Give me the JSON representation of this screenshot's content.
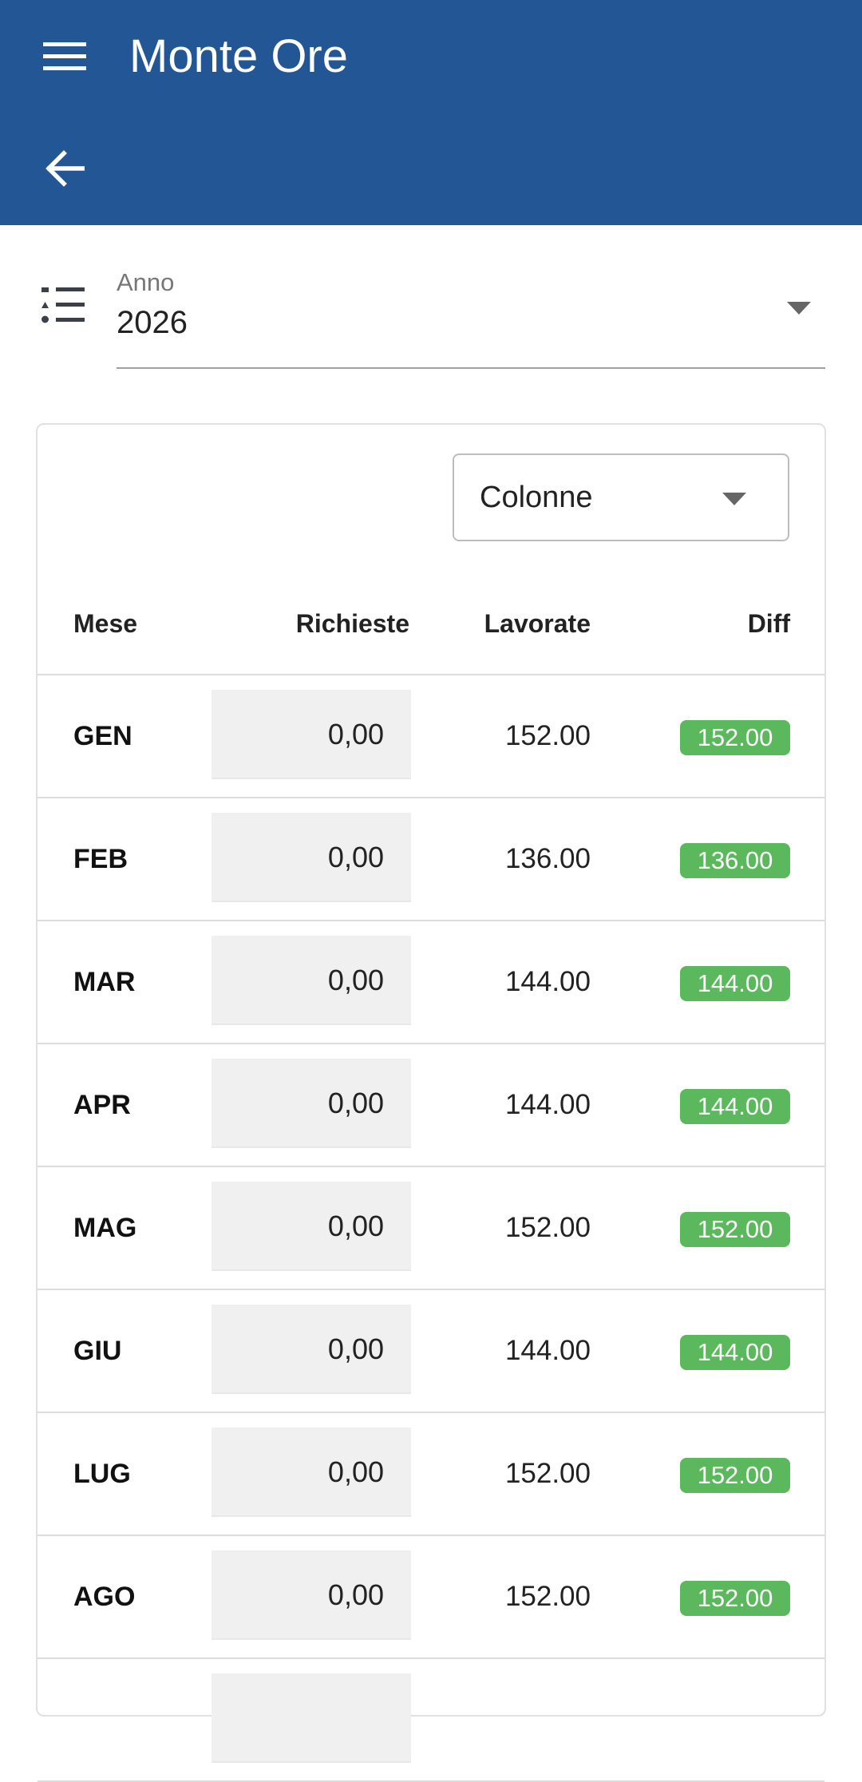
{
  "app": {
    "title": "Monte Ore",
    "header_color": "#235695"
  },
  "filter": {
    "label": "Anno",
    "value": "2026"
  },
  "columns_select": {
    "label": "Colonne"
  },
  "table": {
    "headers": {
      "mese": "Mese",
      "richieste": "Richieste",
      "lavorate": "Lavorate",
      "diff": "Diff"
    },
    "diff_badge_color": "#5cb85c",
    "rows": [
      {
        "mese": "GEN",
        "richieste": "0,00",
        "lavorate": "152.00",
        "diff": "152.00"
      },
      {
        "mese": "FEB",
        "richieste": "0,00",
        "lavorate": "136.00",
        "diff": "136.00"
      },
      {
        "mese": "MAR",
        "richieste": "0,00",
        "lavorate": "144.00",
        "diff": "144.00"
      },
      {
        "mese": "APR",
        "richieste": "0,00",
        "lavorate": "144.00",
        "diff": "144.00"
      },
      {
        "mese": "MAG",
        "richieste": "0,00",
        "lavorate": "152.00",
        "diff": "152.00"
      },
      {
        "mese": "GIU",
        "richieste": "0,00",
        "lavorate": "144.00",
        "diff": "144.00"
      },
      {
        "mese": "LUG",
        "richieste": "0,00",
        "lavorate": "152.00",
        "diff": "152.00"
      },
      {
        "mese": "AGO",
        "richieste": "0,00",
        "lavorate": "152.00",
        "diff": "152.00"
      }
    ]
  },
  "icons": {
    "menu": "menu-icon",
    "back": "arrow-back-icon",
    "year": "list-icon",
    "caret": "caret-down-icon"
  }
}
